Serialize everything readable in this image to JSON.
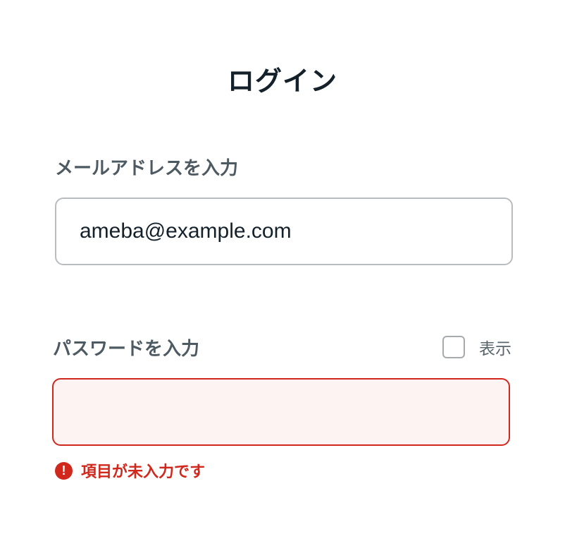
{
  "page": {
    "title": "ログイン"
  },
  "email": {
    "label": "メールアドレスを入力",
    "value": "ameba@example.com"
  },
  "password": {
    "label": "パスワードを入力",
    "value": "",
    "show_label": "表示",
    "show_checked": false,
    "error_icon": "exclamation-circle-icon",
    "error_text": "項目が未入力です"
  },
  "colors": {
    "error": "#d0281c",
    "error_background": "#fdf3f2",
    "border": "#b9bcbf",
    "title": "#14212b",
    "label": "#4e5a62"
  }
}
